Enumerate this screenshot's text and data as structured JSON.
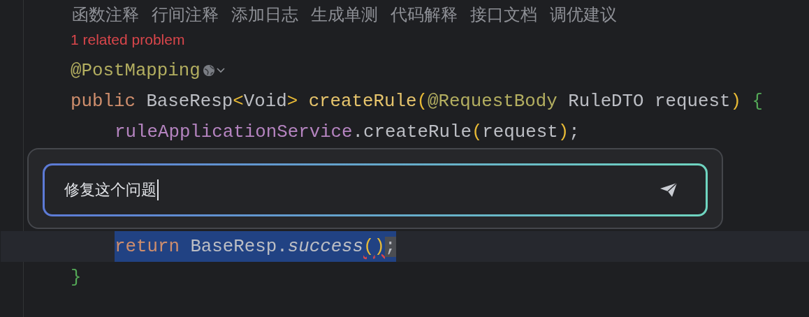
{
  "actions": [
    {
      "label": "函数注释"
    },
    {
      "label": "行间注释"
    },
    {
      "label": "添加日志"
    },
    {
      "label": "生成单测"
    },
    {
      "label": "代码解释"
    },
    {
      "label": "接口文档"
    },
    {
      "label": "调优建议"
    }
  ],
  "problem": "1 related problem",
  "code": [
    {
      "tokens": [
        {
          "kind": "annotation",
          "text": "@PostMapping"
        }
      ],
      "inlay": true
    },
    {
      "tokens": [
        {
          "kind": "keyword",
          "text": "public "
        },
        {
          "kind": "type",
          "text": "BaseResp"
        },
        {
          "kind": "bracket-yellow",
          "text": "<"
        },
        {
          "kind": "type",
          "text": "Void"
        },
        {
          "kind": "bracket-yellow",
          "text": "> "
        },
        {
          "kind": "method",
          "text": "createRule"
        },
        {
          "kind": "bracket-yellow",
          "text": "("
        },
        {
          "kind": "annotation",
          "text": "@RequestBody"
        },
        {
          "kind": "plain",
          "text": " RuleDTO request"
        },
        {
          "kind": "bracket-yellow",
          "text": ") "
        },
        {
          "kind": "bracket-green",
          "text": "{"
        }
      ],
      "children": [
        {
          "tokens": [
            {
              "kind": "field",
              "text": "ruleApplicationService"
            },
            {
              "kind": "plain",
              "text": ".createRule"
            },
            {
              "kind": "bracket-yellow",
              "text": "("
            },
            {
              "kind": "plain",
              "text": "request"
            },
            {
              "kind": "bracket-yellow",
              "text": ")"
            },
            {
              "kind": "plain",
              "text": ";"
            }
          ]
        },
        {
          "tokens": [
            {
              "kind": "keyword",
              "text": "return "
            },
            {
              "kind": "type",
              "text": "BaseResp."
            },
            {
              "kind": "italic",
              "text": "success"
            },
            {
              "kind": "bracket-yellow",
              "text": "(",
              "error": true
            },
            {
              "kind": "bracket-yellow",
              "text": ")",
              "error": true
            },
            {
              "kind": "caret",
              "text": ";"
            }
          ],
          "selected": true
        }
      ]
    },
    {
      "tokens": [
        {
          "kind": "bracket-green",
          "text": "}"
        }
      ]
    }
  ],
  "prompt": {
    "value": "修复这个问题"
  }
}
